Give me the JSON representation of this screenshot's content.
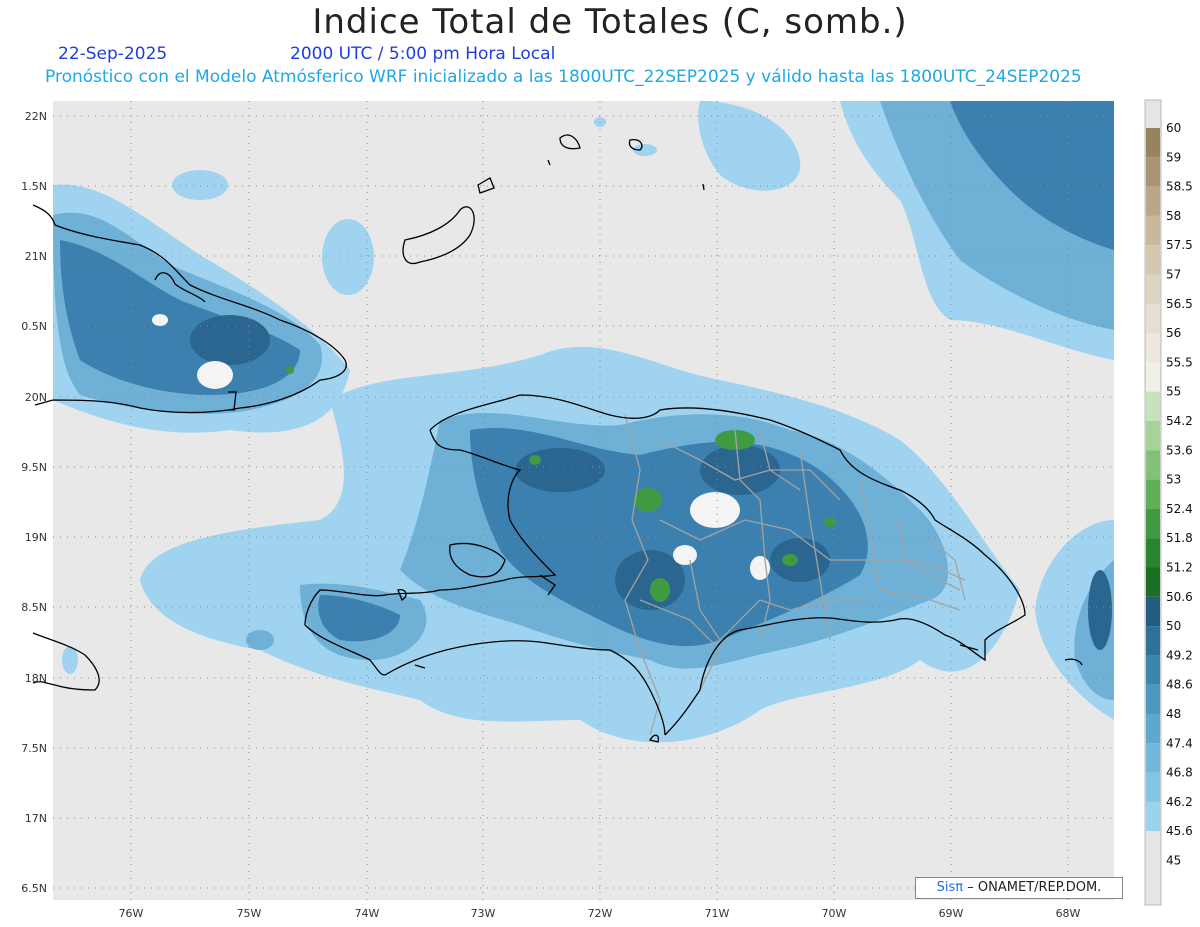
{
  "title": "Indice Total de Totales (C, somb.)",
  "date": "22-Sep-2025",
  "time": "2000 UTC / 5:00 pm Hora Local",
  "description": "Pronóstico con el Modelo Atmósferico WRF inicializado a las 1800UTC_22SEP2025 y válido hasta las  1800UTC_24SEP2025",
  "lat_labels": [
    "22N",
    "1.5N",
    "21N",
    "0.5N",
    "20N",
    "9.5N",
    "19N",
    "8.5N",
    "18N",
    "7.5N",
    "17N",
    "6.5N"
  ],
  "lon_labels": [
    "76W",
    "75W",
    "74W",
    "73W",
    "72W",
    "71W",
    "70W",
    "69W",
    "68W"
  ],
  "colorbar": {
    "labels": [
      "60",
      "59",
      "58.5",
      "58",
      "57.5",
      "57",
      "56.5",
      "56",
      "55.5",
      "55",
      "54.2",
      "53.6",
      "53",
      "52.4",
      "51.8",
      "51.2",
      "50.6",
      "50",
      "49.2",
      "48.6",
      "48",
      "47.4",
      "46.8",
      "46.2",
      "45.6",
      "45"
    ],
    "colors": [
      "#97835f",
      "#ab9474",
      "#bba787",
      "#c9b99b",
      "#d4c8b0",
      "#ddd4c2",
      "#e5dfd3",
      "#ece8e0",
      "#f2efe9",
      "#c6e3bd",
      "#a6d39a",
      "#83c178",
      "#5faf59",
      "#3f9a41",
      "#29862f",
      "#1a6f24",
      "#235e80",
      "#2e7299",
      "#3b85ad",
      "#4b98c0",
      "#5ea8cf",
      "#72b6da",
      "#86c4e3",
      "#9bd2ec",
      "#e5e5e5"
    ]
  },
  "credit": {
    "logo": "Sisπ",
    "text": "– ONAMET/REP.DOM."
  },
  "colors": {
    "background": "#e8e8e8",
    "light_blue": "#9fd3ef",
    "mid_blue": "#5e9fc8",
    "dark_blue": "#2f6f99",
    "green": "#3a8f3a",
    "coast": "#000000",
    "provinces": "#a0a0a0"
  }
}
